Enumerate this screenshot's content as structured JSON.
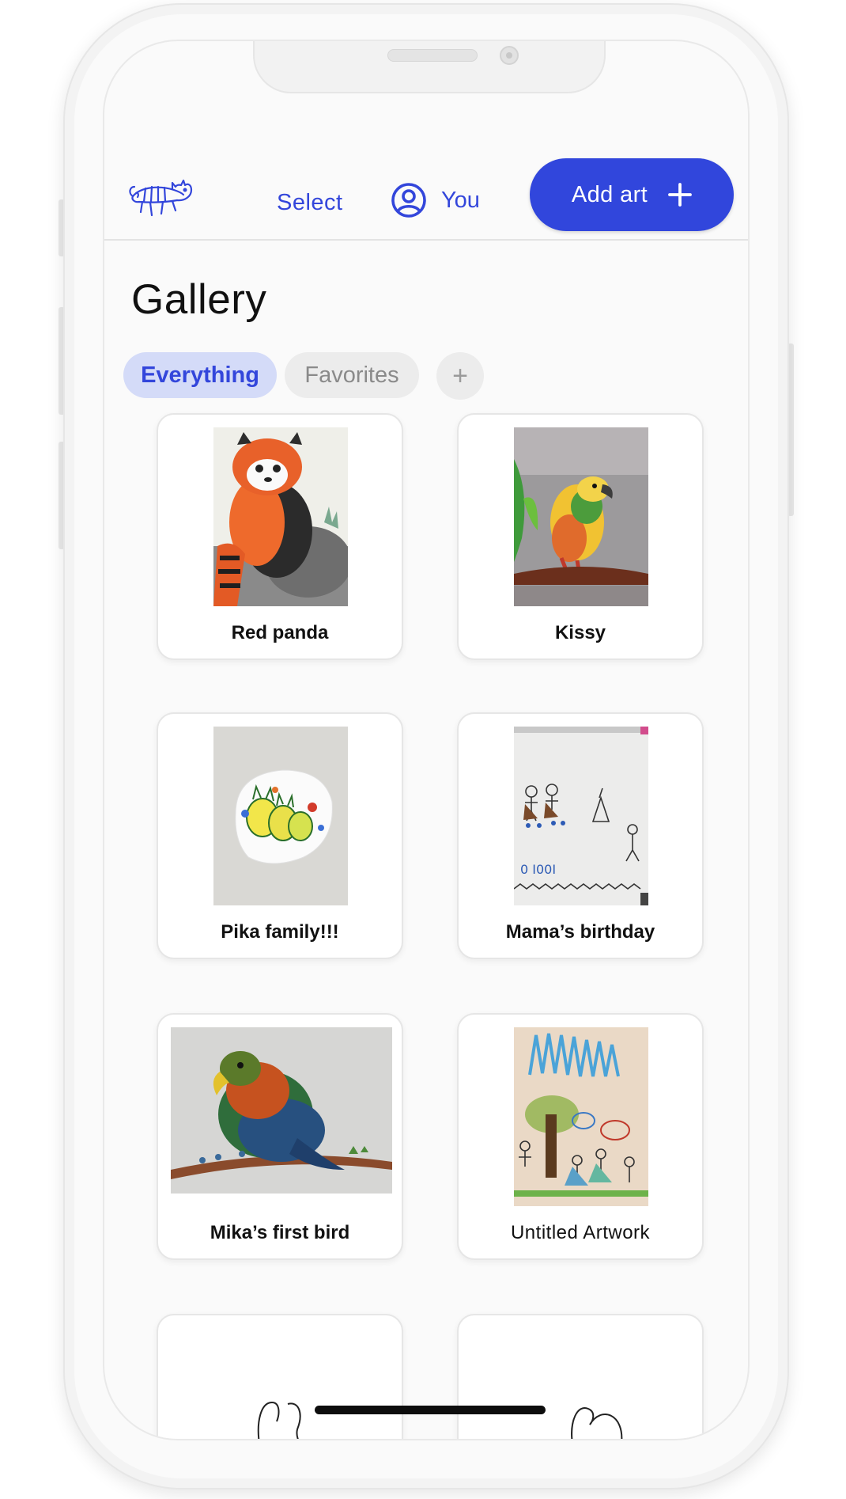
{
  "header": {
    "select_label": "Select",
    "you_label": "You",
    "add_art_label": "Add art"
  },
  "gallery": {
    "title": "Gallery",
    "tabs": [
      {
        "label": "Everything",
        "active": true
      },
      {
        "label": "Favorites",
        "active": false
      }
    ],
    "add_tab_symbol": "+"
  },
  "artworks": [
    {
      "title": "Red panda"
    },
    {
      "title": "Kissy"
    },
    {
      "title": "Pika family!!!"
    },
    {
      "title": "Mama’s birthday"
    },
    {
      "title": "Mika’s first bird"
    },
    {
      "title": "Untitled Artwork"
    }
  ],
  "colors": {
    "accent": "#3146dc",
    "active_tab_bg": "#d4dbf8",
    "inactive_tab_bg": "#ececec",
    "background": "#fafafa"
  },
  "icons": {
    "logo": "cat-doodle-logo",
    "you": "user-circle-icon",
    "add": "plus-icon"
  }
}
